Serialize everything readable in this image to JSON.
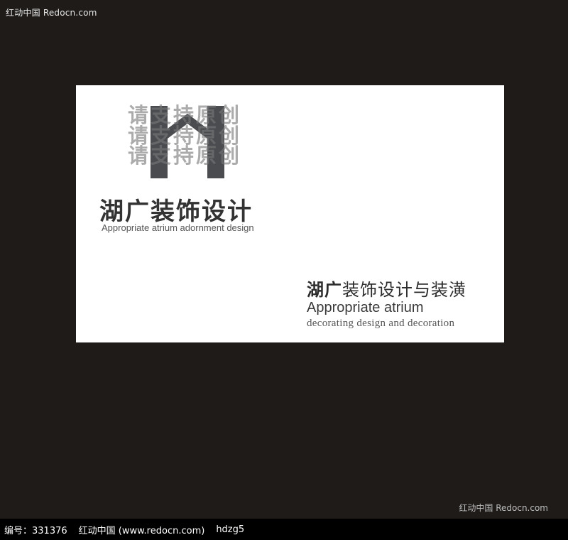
{
  "header": {
    "watermark": "红动中国 Redocn.com"
  },
  "card": {
    "overlay_lines": [
      "请支持原创",
      "请支持原创",
      "请支持原创"
    ],
    "logo": {
      "title_cn": "湖广装饰设计",
      "subtitle_en": "Appropriate atrium adornment design"
    },
    "secondary": {
      "title_bold": "湖广",
      "title_rest": "装饰设计与装潢",
      "line1": "Appropriate atrium",
      "line2": "decorating design and decoration"
    },
    "colors": {
      "background": "#ffffff",
      "logo_mark": "#4a4c50"
    }
  },
  "bottom_watermark": "红动中国 Redocn.com",
  "footer": {
    "code": "编号：331376",
    "site": "红动中国 (www.redocn.com)",
    "user": "hdzg5"
  },
  "page_colors": {
    "background": "#1e1b19",
    "footer": "#000000"
  }
}
